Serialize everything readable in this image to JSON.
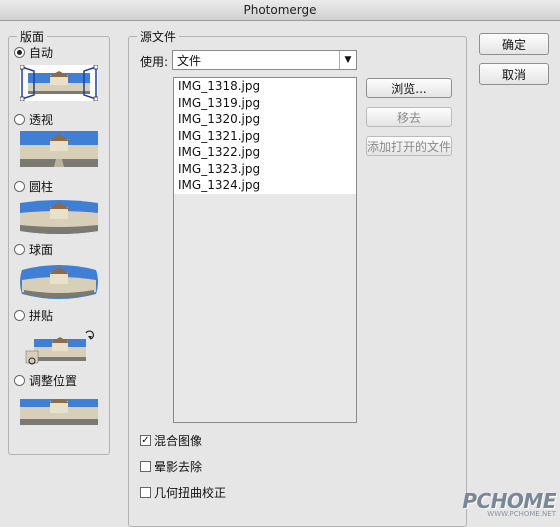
{
  "window": {
    "title": "Photomerge"
  },
  "layout": {
    "title": "版面",
    "options": [
      {
        "label": "自动",
        "checked": true
      },
      {
        "label": "透视",
        "checked": false
      },
      {
        "label": "圆柱",
        "checked": false
      },
      {
        "label": "球面",
        "checked": false
      },
      {
        "label": "拼贴",
        "checked": false
      },
      {
        "label": "调整位置",
        "checked": false
      }
    ]
  },
  "source": {
    "title": "源文件",
    "use_label": "使用:",
    "use_value": "文件",
    "files": [
      "IMG_1318.jpg",
      "IMG_1319.jpg",
      "IMG_1320.jpg",
      "IMG_1321.jpg",
      "IMG_1322.jpg",
      "IMG_1323.jpg",
      "IMG_1324.jpg"
    ],
    "browse_label": "浏览...",
    "remove_label": "移去",
    "add_open_label": "添加打开的文件"
  },
  "buttons": {
    "ok_label": "确定",
    "cancel_label": "取消"
  },
  "options": {
    "blend_label": "混合图像",
    "blend_checked": true,
    "vignette_label": "晕影去除",
    "vignette_checked": false,
    "distortion_label": "几何扭曲校正",
    "distortion_checked": false
  },
  "watermark": {
    "main": "PCHOME",
    "sub": "WWW.PCHOME.NET"
  },
  "colors": {
    "sky": "#3f7fd6",
    "building": "#d8cfb8",
    "roof": "#8a6b4a",
    "ground": "#7a7a72"
  }
}
